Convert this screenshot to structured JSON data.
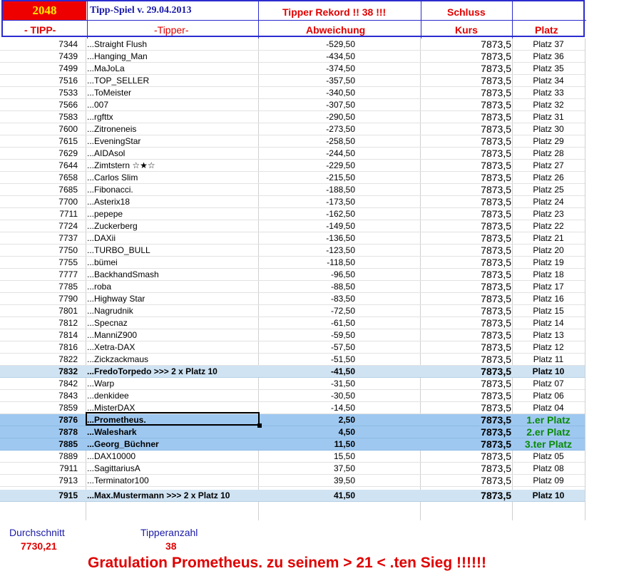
{
  "header": {
    "label_2048": "2048",
    "title": "Tipp-Spiel v. 29.04.2013",
    "rekord": "Tipper Rekord !!  38  !!!",
    "schluss": "Schluss",
    "col_tipp": "- TIPP-",
    "col_tipper": "-Tipper-",
    "col_abweichung": "Abweichung",
    "col_kurs": "Kurs",
    "col_platz": "Platz"
  },
  "rows": [
    {
      "tipp": "7344",
      "name": "...Straight Flush",
      "abw": "-529,50",
      "kurs": "7873,5",
      "platz": "Platz 37"
    },
    {
      "tipp": "7439",
      "name": "...Hanging_Man",
      "abw": "-434,50",
      "kurs": "7873,5",
      "platz": "Platz 36"
    },
    {
      "tipp": "7499",
      "name": "...MaJoLa",
      "abw": "-374,50",
      "kurs": "7873,5",
      "platz": "Platz 35"
    },
    {
      "tipp": "7516",
      "name": "...TOP_SELLER",
      "abw": "-357,50",
      "kurs": "7873,5",
      "platz": "Platz 34"
    },
    {
      "tipp": "7533",
      "name": "...ToMeister",
      "abw": "-340,50",
      "kurs": "7873,5",
      "platz": "Platz 33"
    },
    {
      "tipp": "7566",
      "name": "...007",
      "abw": "-307,50",
      "kurs": "7873,5",
      "platz": "Platz 32"
    },
    {
      "tipp": "7583",
      "name": "...rgfttx",
      "abw": "-290,50",
      "kurs": "7873,5",
      "platz": "Platz 31"
    },
    {
      "tipp": "7600",
      "name": "...Zitroneneis",
      "abw": "-273,50",
      "kurs": "7873,5",
      "platz": "Platz 30"
    },
    {
      "tipp": "7615",
      "name": "...EveningStar",
      "abw": "-258,50",
      "kurs": "7873,5",
      "platz": "Platz 29"
    },
    {
      "tipp": "7629",
      "name": "...AIDAsol",
      "abw": "-244,50",
      "kurs": "7873,5",
      "platz": "Platz 28"
    },
    {
      "tipp": "7644",
      "name": "...Zimtstern ☆★☆",
      "abw": "-229,50",
      "kurs": "7873,5",
      "platz": "Platz 27"
    },
    {
      "tipp": "7658",
      "name": "...Carlos Slim",
      "abw": "-215,50",
      "kurs": "7873,5",
      "platz": "Platz 26"
    },
    {
      "tipp": "7685",
      "name": "...Fibonacci.",
      "abw": "-188,50",
      "kurs": "7873,5",
      "platz": "Platz 25"
    },
    {
      "tipp": "7700",
      "name": "...Asterix18",
      "abw": "-173,50",
      "kurs": "7873,5",
      "platz": "Platz 24"
    },
    {
      "tipp": "7711",
      "name": "...pepepe",
      "abw": "-162,50",
      "kurs": "7873,5",
      "platz": "Platz 23"
    },
    {
      "tipp": "7724",
      "name": "...Zuckerberg",
      "abw": "-149,50",
      "kurs": "7873,5",
      "platz": "Platz 22"
    },
    {
      "tipp": "7737",
      "name": "...DAXii",
      "abw": "-136,50",
      "kurs": "7873,5",
      "platz": "Platz 21"
    },
    {
      "tipp": "7750",
      "name": "...TURBO_BULL",
      "abw": "-123,50",
      "kurs": "7873,5",
      "platz": "Platz 20"
    },
    {
      "tipp": "7755",
      "name": "...bümei",
      "abw": "-118,50",
      "kurs": "7873,5",
      "platz": "Platz 19"
    },
    {
      "tipp": "7777",
      "name": "...BackhandSmash",
      "abw": "-96,50",
      "kurs": "7873,5",
      "platz": "Platz 18"
    },
    {
      "tipp": "7785",
      "name": "...roba",
      "abw": "-88,50",
      "kurs": "7873,5",
      "platz": "Platz 17"
    },
    {
      "tipp": "7790",
      "name": "...Highway Star",
      "abw": "-83,50",
      "kurs": "7873,5",
      "platz": "Platz 16"
    },
    {
      "tipp": "7801",
      "name": "...Nagrudnik",
      "abw": "-72,50",
      "kurs": "7873,5",
      "platz": "Platz 15"
    },
    {
      "tipp": "7812",
      "name": "...Specnaz",
      "abw": "-61,50",
      "kurs": "7873,5",
      "platz": "Platz 14"
    },
    {
      "tipp": "7814",
      "name": "...ManniZ900",
      "abw": "-59,50",
      "kurs": "7873,5",
      "platz": "Platz 13"
    },
    {
      "tipp": "7816",
      "name": "...Xetra-DAX",
      "abw": "-57,50",
      "kurs": "7873,5",
      "platz": "Platz 12"
    },
    {
      "tipp": "7822",
      "name": "...Zickzackmaus",
      "abw": "-51,50",
      "kurs": "7873,5",
      "platz": "Platz 11"
    },
    {
      "tipp": "7832",
      "name": "...FredoTorpedo  >>> 2 x Platz 10",
      "abw": "-41,50",
      "kurs": "7873,5",
      "platz": "Platz 10",
      "style": "hl"
    },
    {
      "tipp": "7842",
      "name": "...Warp",
      "abw": "-31,50",
      "kurs": "7873,5",
      "platz": "Platz 07"
    },
    {
      "tipp": "7843",
      "name": "...denkidee",
      "abw": "-30,50",
      "kurs": "7873,5",
      "platz": "Platz 06"
    },
    {
      "tipp": "7859",
      "name": "...MisterDAX",
      "abw": "-14,50",
      "kurs": "7873,5",
      "platz": "Platz 04"
    },
    {
      "tipp": "7876",
      "name": "...Prometheus.",
      "abw": "2,50",
      "kurs": "7873,5",
      "platz": "1.er Platz",
      "style": "win"
    },
    {
      "tipp": "7878",
      "name": "...Waleshark",
      "abw": "4,50",
      "kurs": "7873,5",
      "platz": "2.er Platz",
      "style": "win"
    },
    {
      "tipp": "7885",
      "name": "...Georg_Büchner",
      "abw": "11,50",
      "kurs": "7873,5",
      "platz": "3.ter Platz",
      "style": "win"
    },
    {
      "tipp": "7889",
      "name": "...DAX10000",
      "abw": "15,50",
      "kurs": "7873,5",
      "platz": "Platz 05"
    },
    {
      "tipp": "7911",
      "name": "...SagittariusA",
      "abw": "37,50",
      "kurs": "7873,5",
      "platz": "Platz 08"
    },
    {
      "tipp": "7913",
      "name": "...Terminator100",
      "abw": "39,50",
      "kurs": "7873,5",
      "platz": "Platz 09"
    },
    {
      "tipp": "7915",
      "name": "...Max.Mustermann   >>> 2 x Platz 10",
      "abw": "41,50",
      "kurs": "7873,5",
      "platz": "Platz 10",
      "style": "hl"
    }
  ],
  "footer": {
    "durchschnitt_label": "Durchschnitt",
    "durchschnitt_value": "7730,21",
    "tipperanzahl_label": "Tipperanzahl",
    "tipperanzahl_value": "38",
    "gratulation": "Gratulation Prometheus.   zu seinem > 21 < .ten Sieg !!!!!!"
  }
}
